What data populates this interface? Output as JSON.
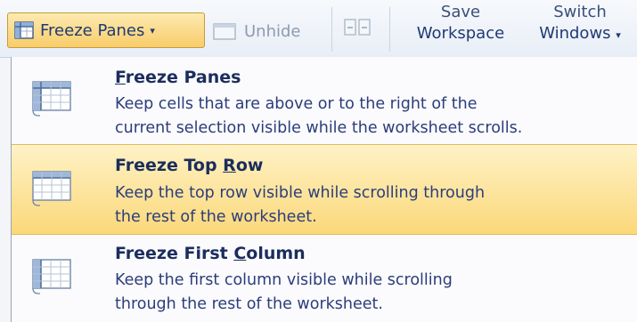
{
  "ribbon": {
    "freeze_panes_button": {
      "label": "Freeze Panes",
      "icon": "freeze-panes-icon"
    },
    "unhide_button": {
      "label": "Unhide",
      "icon": "unhide-window-icon"
    },
    "view_side_by_side_icon": "view-side-by-side-icon",
    "save_workspace": {
      "line1": "Save",
      "line2": "Workspace"
    },
    "switch_windows": {
      "line1": "Switch",
      "line2": "Windows"
    },
    "colors": {
      "highlight": "#fbd879",
      "label": "#1f3a73",
      "disabled": "#8c9bb0"
    }
  },
  "menu": {
    "items": [
      {
        "title_prefix": "",
        "title_access": "F",
        "title_rest": "reeze Panes",
        "desc_line1": "Keep cells that are above or to the right of the",
        "desc_line2": "current selection visible while the worksheet scrolls.",
        "icon": "freeze-panes-grid-icon",
        "highlighted": false
      },
      {
        "title_prefix": "Freeze Top ",
        "title_access": "R",
        "title_rest": "ow",
        "desc_line1": "Keep the top row visible while scrolling through",
        "desc_line2": "the rest of the worksheet.",
        "icon": "freeze-top-row-icon",
        "highlighted": true
      },
      {
        "title_prefix": "Freeze First ",
        "title_access": "C",
        "title_rest": "olumn",
        "desc_line1": "Keep the first column visible while scrolling",
        "desc_line2": "through the rest of the worksheet.",
        "icon": "freeze-first-column-icon",
        "highlighted": false
      }
    ]
  }
}
